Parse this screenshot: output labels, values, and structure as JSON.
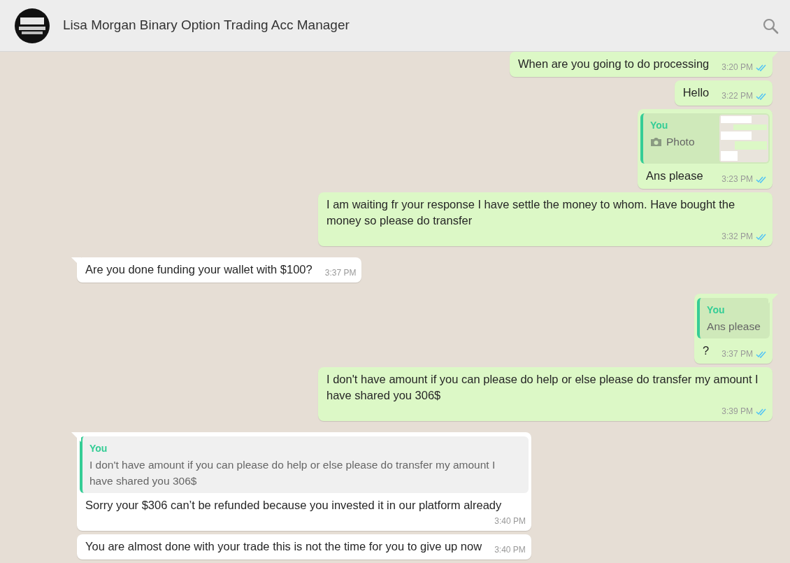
{
  "header": {
    "title": "Lisa Morgan Binary Option Trading Acc Manager"
  },
  "messages": [
    {
      "outgoing": true,
      "text": "When are you going to do processing",
      "time": "3:20 PM",
      "read": true
    },
    {
      "outgoing": true,
      "text": "Hello",
      "time": "3:22 PM",
      "read": true
    },
    {
      "outgoing": true,
      "quote": {
        "author": "You",
        "text": "Photo"
      },
      "text": "Ans please",
      "time": "3:23 PM",
      "read": true
    },
    {
      "outgoing": true,
      "text": "I am waiting fr your response I have settle the money to whom. Have bought the money so please do transfer",
      "time": "3:32 PM",
      "read": true
    },
    {
      "outgoing": false,
      "text": "Are you done funding your wallet with $100?",
      "time": "3:37 PM"
    },
    {
      "outgoing": true,
      "quote": {
        "author": "You",
        "kind": "text",
        "text": "Ans please"
      },
      "text": "?",
      "time": "3:37 PM",
      "read": true
    },
    {
      "outgoing": true,
      "text": "I don't have amount if  you can please do help or else please do transfer my amount I have shared you 306$",
      "time": "3:39 PM",
      "read": true
    },
    {
      "outgoing": false,
      "quote": {
        "author": "You",
        "kind": "text",
        "text": "I don't have amount if  you can please do help or else please do transfer my amount I have shared you 306$"
      },
      "text": "Sorry your $306 can’t be refunded because you invested it in our platform already",
      "time": "3:40 PM"
    },
    {
      "outgoing": false,
      "text": "You are almost done with your trade this is not the time for you to give up now",
      "time": "3:40 PM"
    }
  ]
}
